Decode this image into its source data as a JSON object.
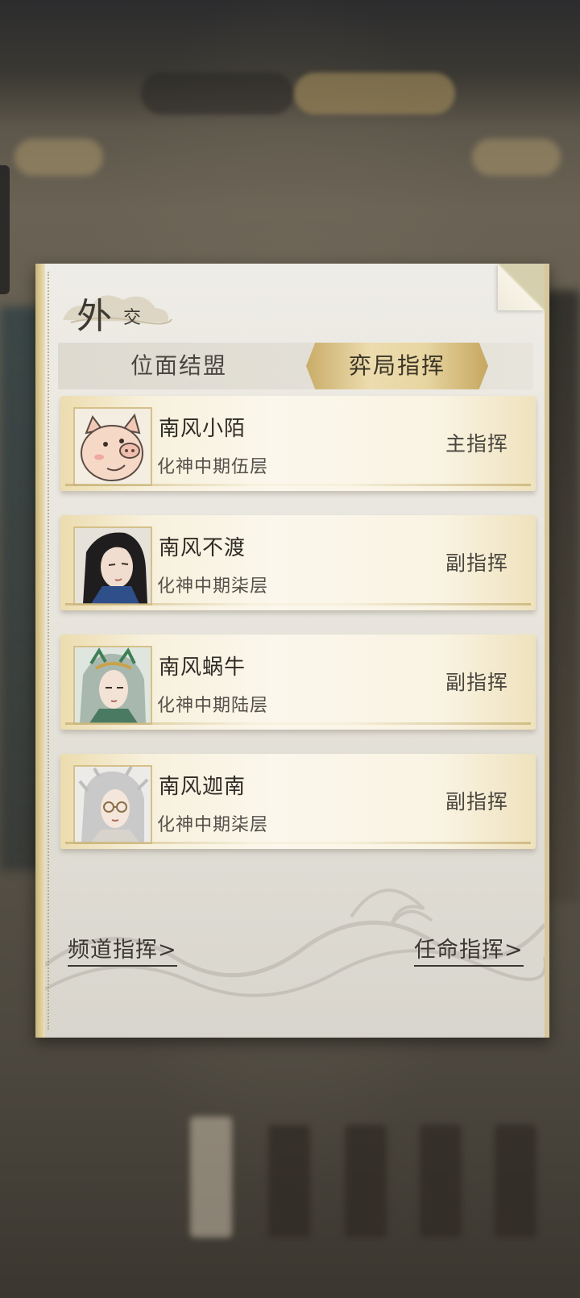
{
  "panel": {
    "title_main": "外",
    "title_sub": "交"
  },
  "tabs": [
    {
      "label": "位面结盟",
      "active": false
    },
    {
      "label": "弈局指挥",
      "active": true
    }
  ],
  "members": [
    {
      "name": "南风小陌",
      "rank": "化神中期伍层",
      "role": "主指挥",
      "avatar": "pig-avatar-icon"
    },
    {
      "name": "南风不渡",
      "rank": "化神中期柒层",
      "role": "副指挥",
      "avatar": "dark-hair-character-avatar"
    },
    {
      "name": "南风蜗牛",
      "rank": "化神中期陆层",
      "role": "副指挥",
      "avatar": "green-hair-character-avatar"
    },
    {
      "name": "南风迦南",
      "rank": "化神中期柒层",
      "role": "副指挥",
      "avatar": "silver-hair-character-avatar"
    }
  ],
  "footer": {
    "channel_command": "频道指挥>",
    "appoint_command": "任命指挥>"
  },
  "colors": {
    "panel": "#eeece6",
    "accent_gold": "#c9ac68",
    "text_dark": "#2f2b25"
  }
}
